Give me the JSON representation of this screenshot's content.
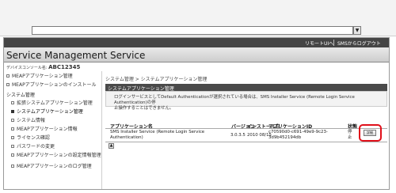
{
  "browser": {
    "address_value": ""
  },
  "topbar": {
    "remote_ui_label": "リモートUIへ",
    "from_sms_label": "SMSからログアウト"
  },
  "app_title": "Service Management Service",
  "device_name": {
    "label": "デバイスコンソール名:",
    "value": "ABC12345"
  },
  "sidebar": {
    "top_items": [
      "MEAPアプリケーション管理",
      "MEAPアプリケーションのインストール"
    ],
    "section_heading": "システム管理",
    "section_items": [
      "拡張システムアプリケーション管理",
      "システムアプリケーション管理",
      "システム情報",
      "MEAPアプリケーション情報",
      "ライセンス確認",
      "パスワードの変更",
      "MEAPアプリケーションの設定情報管理",
      "MEAPアプリケーションのログ管理"
    ]
  },
  "breadcrumb": "システム管理 > システムアプリケーション管理",
  "panel": {
    "title": "システムアプリケーション管理",
    "notice_line1": "ログインサービスとしてDefault Authenticationが選択されている場合は、SMS Installer Service (Remote Login Service Authentication)の停",
    "notice_line2": "止操作することはできません。"
  },
  "table": {
    "headers": {
      "app_name": "アプリケーション名",
      "version": "バージョン",
      "install_date": "インストール日",
      "app_id": "アプリケーションID",
      "status": "状態"
    },
    "row": {
      "name_line1": "SMS Installer Service (Remote Login Service",
      "name_line2": "Authentication)",
      "version": "3.0.3.5",
      "install_date": "2010 08/15",
      "id_line1": "c70590d0-c691-49e9-9c23-",
      "id_line2": "3d9b452194db",
      "status_line1": "停",
      "status_line2": "止",
      "details_label": "詳細"
    }
  },
  "scroll_top_icon": "up-arrow-icon",
  "colors": {
    "topbar": "#454545",
    "highlight": "#e0101a"
  }
}
